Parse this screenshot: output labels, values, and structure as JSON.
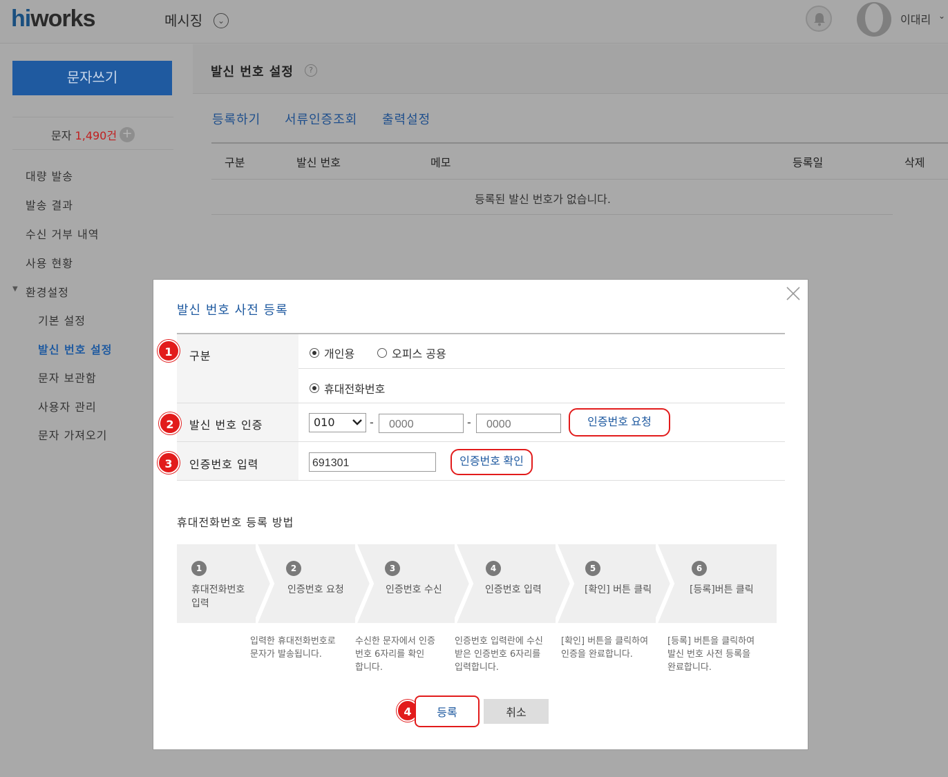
{
  "header": {
    "logo_hi": "hi",
    "logo_rest": "works",
    "app_title": "메시징",
    "user_name": "이대리"
  },
  "sidebar": {
    "compose": "문자쓰기",
    "sms_label": "문자",
    "sms_count": "1,490건",
    "items": [
      {
        "label": "대량 발송"
      },
      {
        "label": "발송 결과"
      },
      {
        "label": "수신 거부 내역"
      },
      {
        "label": "사용 현황"
      },
      {
        "label": "환경설정"
      },
      {
        "label": "기본 설정"
      },
      {
        "label": "발신 번호 설정"
      },
      {
        "label": "문자 보관함"
      },
      {
        "label": "사용자 관리"
      },
      {
        "label": "문자 가져오기"
      }
    ]
  },
  "main": {
    "title": "발신 번호 설정",
    "tabs": [
      "등록하기",
      "서류인증조회",
      "출력설정"
    ],
    "columns": [
      "구분",
      "발신 번호",
      "메모",
      "등록일",
      "삭제"
    ],
    "empty": "등록된 발신 번호가 없습니다."
  },
  "modal": {
    "title": "발신 번호 사전 등록",
    "rows": {
      "type_label": "구분",
      "opt_personal": "개인용",
      "opt_office": "오피스 공용",
      "opt_mobile": "휴대전화번호",
      "verify_label": "발신 번호 인증",
      "prefix": "010",
      "mid_placeholder": "0000",
      "last_placeholder": "0000",
      "request_btn": "인증번호 요청",
      "code_label": "인증번호 입력",
      "code_value": "691301",
      "confirm_btn": "인증번호 확인"
    },
    "badges": [
      "1",
      "2",
      "3",
      "4"
    ],
    "how_title": "휴대전화번호 등록 방법",
    "steps": [
      {
        "num": "1",
        "label1": "휴대전화번호",
        "label2": "입력"
      },
      {
        "num": "2",
        "label1": "인증번호 요청",
        "label2": ""
      },
      {
        "num": "3",
        "label1": "인증번호 수신",
        "label2": ""
      },
      {
        "num": "4",
        "label1": "인증번호 입력",
        "label2": ""
      },
      {
        "num": "5",
        "label1": "[확인] 버튼 클릭",
        "label2": ""
      },
      {
        "num": "6",
        "label1": "[등록]버튼 클릭",
        "label2": ""
      }
    ],
    "descs": [
      {
        "l1": "입력한 휴대전화번호로",
        "l2": "문자가 발송됩니다.",
        "l3": ""
      },
      {
        "l1": "수신한 문자에서 인증",
        "l2": "번호 6자리를 확인",
        "l3": "합니다."
      },
      {
        "l1": "인증번호 입력란에 수신",
        "l2": "받은 인증번호 6자리를",
        "l3": "입력합니다."
      },
      {
        "l1": "[확인] 버튼을 클릭하여",
        "l2": "인증을 완료합니다.",
        "l3": ""
      },
      {
        "l1": "[등록] 버튼을 클릭하여",
        "l2": "발신 번호 사전 등록을",
        "l3": "완료합니다."
      }
    ],
    "submit": "등록",
    "cancel": "취소"
  },
  "colors": {
    "brand_blue": "#1f5aa0",
    "highlight_red": "#e21b1b",
    "overlay_gray": "#a9a9a9"
  }
}
